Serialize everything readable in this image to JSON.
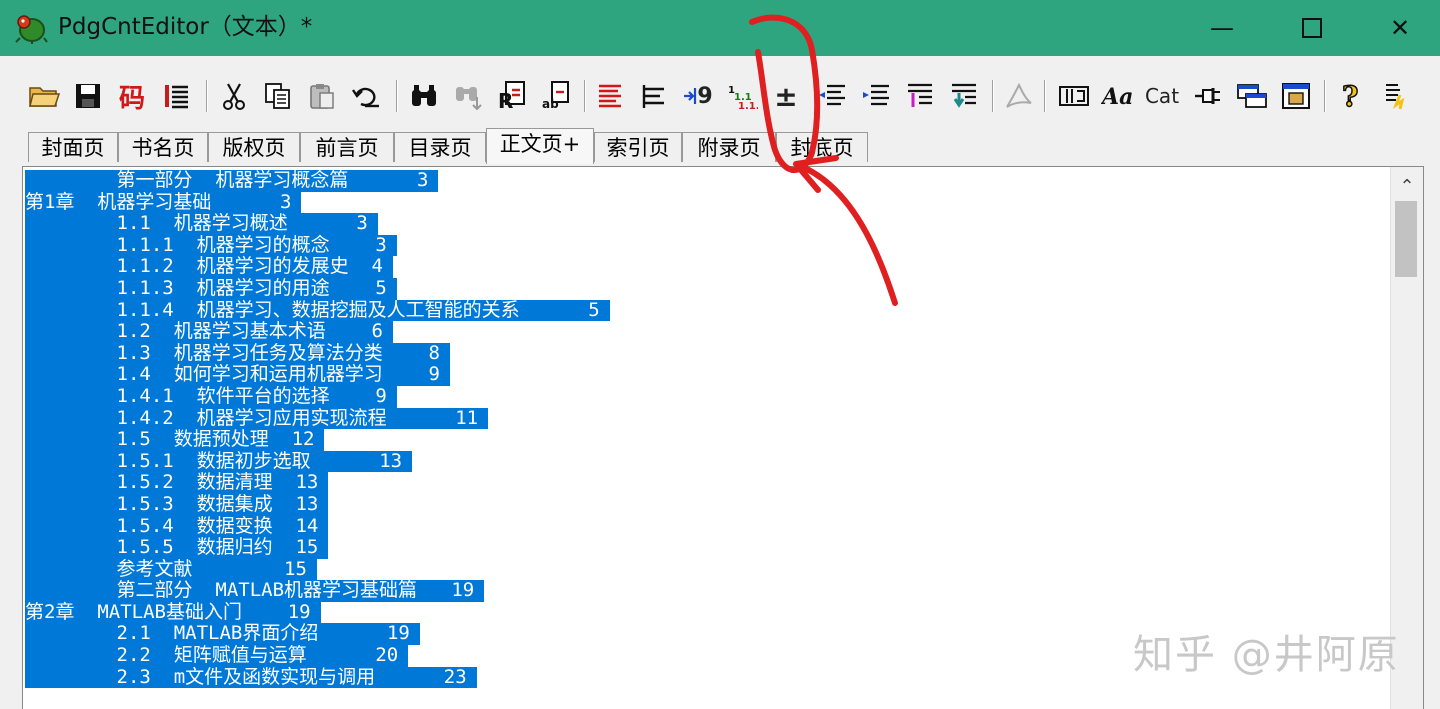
{
  "window": {
    "title": "PdgCntEditor（文本）*",
    "min_glyph": "—",
    "max_glyph": "☐",
    "close_glyph": "✕"
  },
  "toolbar": {
    "code_label": "码",
    "cat_label": "Cat",
    "pm_label": "±",
    "n9_label": "9"
  },
  "tabs": [
    {
      "label": "封面页"
    },
    {
      "label": "书名页"
    },
    {
      "label": "版权页"
    },
    {
      "label": "前言页"
    },
    {
      "label": "目录页"
    },
    {
      "label": "正文页+"
    },
    {
      "label": "索引页"
    },
    {
      "label": "附录页"
    },
    {
      "label": "封底页"
    }
  ],
  "active_tab": "正文页+",
  "editor": {
    "selection_color": "#0078d7",
    "lines": [
      "        第一部分  机器学习概念篇      3",
      "第1章  机器学习基础      3",
      "        1.1  机器学习概述      3",
      "        1.1.1  机器学习的概念    3",
      "        1.1.2  机器学习的发展史  4",
      "        1.1.3  机器学习的用途    5",
      "        1.1.4  机器学习、数据挖掘及人工智能的关系      5",
      "        1.2  机器学习基本术语    6",
      "        1.3  机器学习任务及算法分类    8",
      "        1.4  如何学习和运用机器学习    9",
      "        1.4.1  软件平台的选择    9",
      "        1.4.2  机器学习应用实现流程      11",
      "        1.5  数据预处理  12",
      "        1.5.1  数据初步选取      13",
      "        1.5.2  数据清理  13",
      "        1.5.3  数据集成  13",
      "        1.5.4  数据变换  14",
      "        1.5.5  数据归约  15",
      "        参考文献        15",
      "        第二部分  MATLAB机器学习基础篇   19",
      "第2章  MATLAB基础入门    19",
      "        2.1  MATLAB界面介绍      19",
      "        2.2  矩阵赋值与运算      20",
      "        2.3  m文件及函数实现与调用      23"
    ]
  },
  "scroll": {
    "up_glyph": "⌃"
  },
  "watermark": "知乎 @井阿原",
  "annotation_color": "#e02020"
}
